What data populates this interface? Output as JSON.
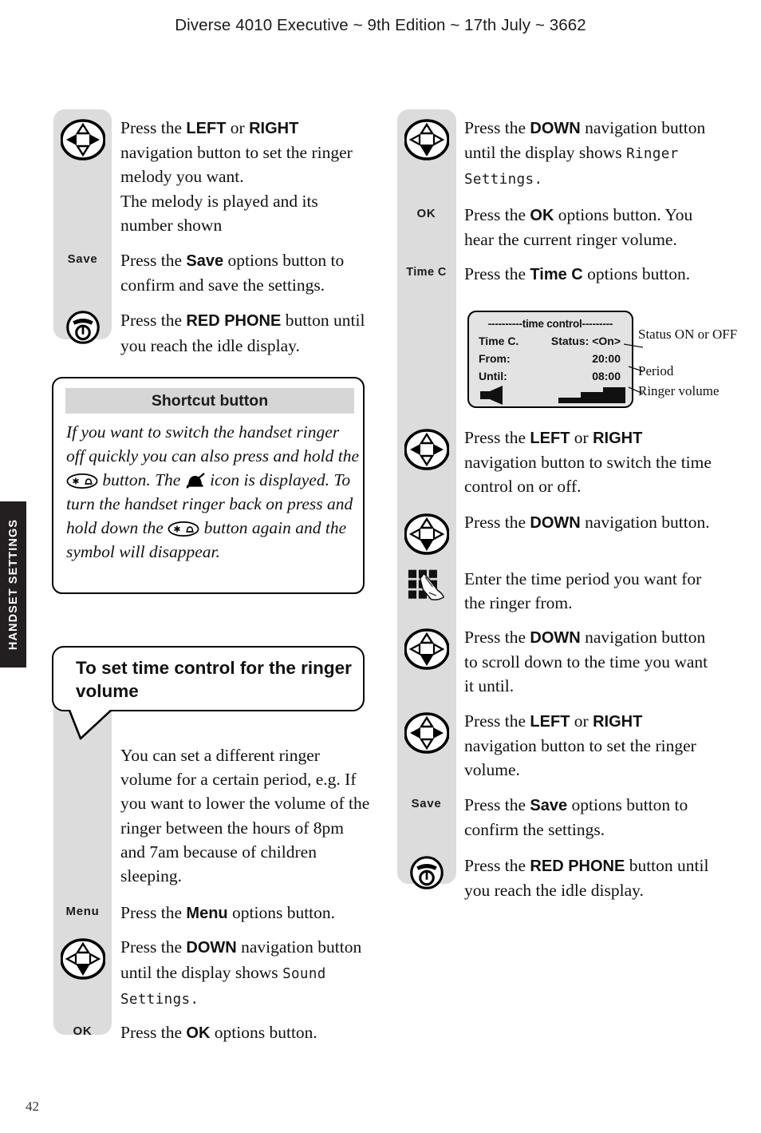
{
  "header": {
    "running_head": "Diverse 4010 Executive ~ 9th Edition ~ 17th July ~ 3662"
  },
  "side_tab": {
    "label": "HANDSET SETTINGS"
  },
  "page_number": "42",
  "left_column": {
    "steps_top": [
      {
        "gutter_icon": "nav-left-right-icon",
        "gutter_label": "",
        "text_html": "Press the <b>LEFT</b> or <b>RIGHT</b> navigation button to set the ringer melody you want.<br>The melody is played and its number shown"
      },
      {
        "gutter_icon": "",
        "gutter_label": "Save",
        "text_html": "Press the <b>Save</b> options button to confirm and save the settings."
      },
      {
        "gutter_icon": "red-phone-icon",
        "gutter_label": "",
        "text_html": "Press the <b>RED PHONE</b> button until you reach the idle display."
      }
    ],
    "shortcut_box": {
      "title": "Shortcut button",
      "text_part1": "If you want to switch the handset ringer off quickly you can also press and hold the ",
      "key_glyph_1": "star-bell-key-icon",
      "text_part2": " button. The ",
      "mute_glyph": "ringer-off-bell-icon",
      "text_part3": " icon is displayed. To turn the handset ringer back on press and hold down the ",
      "key_glyph_2": "star-bell-key-icon",
      "text_part4": " button again and the symbol will disappear."
    },
    "callout": {
      "heading": "To set time control for the ringer volume"
    },
    "steps_bottom": [
      {
        "gutter_icon": "",
        "gutter_label": "",
        "text_html": "You can set a different ringer volume for a certain period, e.g. If you want to lower the volume of the ringer between the hours of 8pm and 7am because of children sleeping."
      },
      {
        "gutter_icon": "",
        "gutter_label": "Menu",
        "text_html": "Press the <b>Menu</b> options button."
      },
      {
        "gutter_icon": "nav-down-icon",
        "gutter_label": "",
        "text_html": "Press the <b>DOWN</b> navigation button until the display shows <span class=\"lcdtext\">Sound Settings.</span>"
      },
      {
        "gutter_icon": "",
        "gutter_label": "OK",
        "text_html": "Press the <b>OK</b> options button."
      }
    ]
  },
  "right_column": {
    "steps_top": [
      {
        "gutter_icon": "nav-down-icon",
        "gutter_label": "",
        "text_html": "Press the <b>DOWN</b> navigation button until the display shows <span class=\"lcdtext\">Ringer Settings.</span>"
      },
      {
        "gutter_icon": "",
        "gutter_label": "OK",
        "text_html": "Press the <b>OK</b> options button. You hear the current ringer volume."
      },
      {
        "gutter_icon": "",
        "gutter_label": "Time C",
        "text_html": "Press the <b>Time C</b> options button."
      }
    ],
    "lcd_figure": {
      "screen_title": "----------time control---------",
      "rows": [
        {
          "label": "Time C.",
          "value": "Status: <On>"
        },
        {
          "label": "From:",
          "value": "20:00"
        },
        {
          "label": "Until:",
          "value": "08:00"
        }
      ],
      "speaker_icon": "speaker-icon",
      "volume_icon": "volume-bars-icon",
      "annotations": [
        "Status ON or OFF",
        "Period",
        "Ringer volume"
      ]
    },
    "steps_bottom": [
      {
        "gutter_icon": "nav-left-right-icon",
        "gutter_label": "",
        "text_html": "Press the <b>LEFT</b> or <b>RIGHT</b> navigation button to switch the time control on or off."
      },
      {
        "gutter_icon": "nav-down-icon",
        "gutter_label": "",
        "text_html": "Press the <b>DOWN</b> navigation button."
      },
      {
        "gutter_icon": "keypad-hand-icon",
        "gutter_label": "",
        "text_html": "Enter the time period you want for the ringer from."
      },
      {
        "gutter_icon": "nav-down-icon",
        "gutter_label": "",
        "text_html": "Press the <b>DOWN</b> navigation button to scroll down to the time you want it until."
      },
      {
        "gutter_icon": "nav-left-right-icon",
        "gutter_label": "",
        "text_html": "Press the <b>LEFT</b> or <b>RIGHT</b> navigation button to set the ringer volume."
      },
      {
        "gutter_icon": "",
        "gutter_label": "Save",
        "text_html": "Press the <b>Save</b> options button to confirm the settings."
      },
      {
        "gutter_icon": "red-phone-icon",
        "gutter_label": "",
        "text_html": "Press the <b>RED PHONE</b> button until you reach the idle display."
      }
    ]
  },
  "colors": {
    "rail_gray": "#dcdcdc",
    "tab_black": "#231f20",
    "title_band": "#d6d6d6",
    "lcd_bg": "#e3e3e3"
  }
}
